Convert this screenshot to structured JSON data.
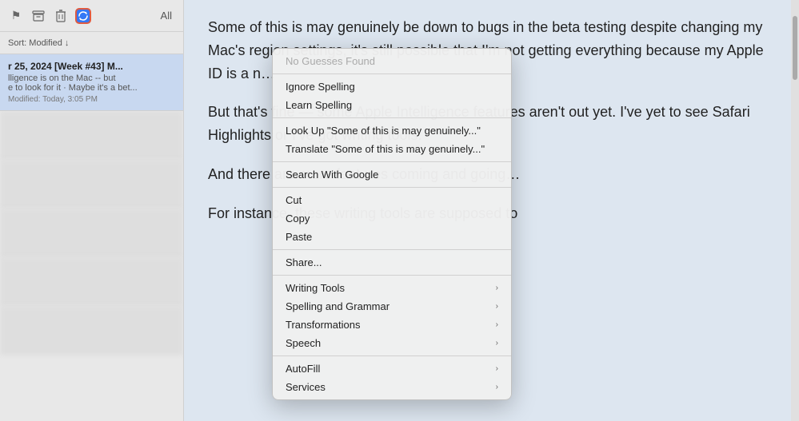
{
  "sidebar": {
    "all_label": "All",
    "sort_label": "Sort: Modified ↓",
    "active_item": {
      "title": "r 25, 2024 [Week #43] M...",
      "preview_line1": "lligence is on the Mac -- but",
      "preview_line2": "e to look for it · Maybe it's a bet...",
      "meta": "Modified: Today, 3:05 PM"
    }
  },
  "toolbar": {
    "flag_icon": "⚑",
    "archive_icon": "📥",
    "trash_icon": "🗑",
    "sync_icon": "⟳"
  },
  "article": {
    "paragraph1": "Some of this is may genuinely be down to bugs in the beta testing despite changing my Mac's region settings, it's still possible that I'm not getting everything because my Apple ID is a n…",
    "paragraph2": "But that's fine — some Apple Intelligence features aren't out yet. I've yet to see Safari Highlights or I've got writing tools.",
    "paragraph3": "And there are more features coming and going…",
    "paragraph4": "For instance, these writing tools are supposed to"
  },
  "context_menu": {
    "items": [
      {
        "id": "no-guesses",
        "label": "No Guesses Found",
        "disabled": true,
        "has_arrow": false
      },
      {
        "id": "separator1",
        "type": "separator"
      },
      {
        "id": "ignore-spelling",
        "label": "Ignore Spelling",
        "disabled": false,
        "has_arrow": false
      },
      {
        "id": "learn-spelling",
        "label": "Learn Spelling",
        "disabled": false,
        "has_arrow": false
      },
      {
        "id": "separator2",
        "type": "separator"
      },
      {
        "id": "look-up",
        "label": "Look Up \"Some of this is may genuinely...\"",
        "disabled": false,
        "has_arrow": false
      },
      {
        "id": "translate",
        "label": "Translate \"Some of this is may genuinely...\"",
        "disabled": false,
        "has_arrow": false
      },
      {
        "id": "separator3",
        "type": "separator"
      },
      {
        "id": "search-google",
        "label": "Search With Google",
        "disabled": false,
        "has_arrow": false
      },
      {
        "id": "separator4",
        "type": "separator"
      },
      {
        "id": "cut",
        "label": "Cut",
        "disabled": false,
        "has_arrow": false
      },
      {
        "id": "copy",
        "label": "Copy",
        "disabled": false,
        "has_arrow": false
      },
      {
        "id": "paste",
        "label": "Paste",
        "disabled": false,
        "has_arrow": false
      },
      {
        "id": "separator5",
        "type": "separator"
      },
      {
        "id": "share",
        "label": "Share...",
        "disabled": false,
        "has_arrow": false
      },
      {
        "id": "separator6",
        "type": "separator"
      },
      {
        "id": "writing-tools",
        "label": "Writing Tools",
        "disabled": false,
        "has_arrow": true
      },
      {
        "id": "spelling-grammar",
        "label": "Spelling and Grammar",
        "disabled": false,
        "has_arrow": true
      },
      {
        "id": "transformations",
        "label": "Transformations",
        "disabled": false,
        "has_arrow": true
      },
      {
        "id": "speech",
        "label": "Speech",
        "disabled": false,
        "has_arrow": true
      },
      {
        "id": "separator7",
        "type": "separator"
      },
      {
        "id": "autofill",
        "label": "AutoFill",
        "disabled": false,
        "has_arrow": true
      },
      {
        "id": "services",
        "label": "Services",
        "disabled": false,
        "has_arrow": true
      }
    ]
  }
}
